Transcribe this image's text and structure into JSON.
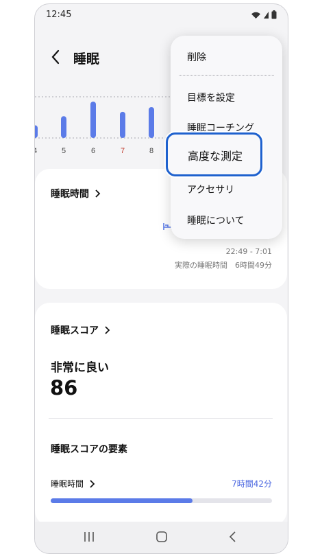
{
  "status": {
    "time": "12:45"
  },
  "header": {
    "title": "睡眠"
  },
  "chart_data": {
    "type": "bar",
    "categories": [
      "4",
      "5",
      "6",
      "7",
      "8"
    ],
    "values": [
      0.35,
      0.6,
      1.0,
      0.72,
      0.85
    ],
    "highlight_category": "7",
    "bar_color": "#5b7be8",
    "highlight_label_color": "#c0392b"
  },
  "sleep_card": {
    "title": "睡眠時間",
    "range": "22:49 - 7:01",
    "actual": "実際の睡眠時間　6時間49分"
  },
  "score_card": {
    "title": "睡眠スコア",
    "rating": "非常に良い",
    "score": "86",
    "factors_title": "睡眠スコアの要素",
    "factor": {
      "label": "睡眠時間",
      "value": "7時間42分",
      "progress": 0.64
    }
  },
  "menu": {
    "items": [
      "削除",
      "目標を設定",
      "睡眠コーチング",
      "高度な測定",
      "アクセサリ",
      "睡眠について"
    ],
    "highlighted_index": 3
  },
  "colors": {
    "accent": "#5b7be8",
    "highlight_border": "#1e61ce"
  }
}
